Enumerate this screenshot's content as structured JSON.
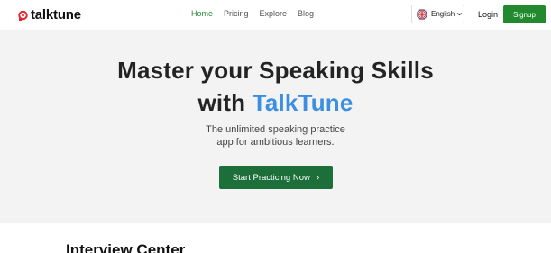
{
  "header": {
    "logo_text": "talktune",
    "nav": [
      {
        "label": "Home",
        "active": true
      },
      {
        "label": "Pricing",
        "active": false
      },
      {
        "label": "Explore",
        "active": false
      },
      {
        "label": "Blog",
        "active": false
      }
    ],
    "language": {
      "label": "English",
      "flag_icon": "uk-flag-icon"
    },
    "login_label": "Login",
    "signup_label": "Signup"
  },
  "hero": {
    "title_line1": "Master your Speaking Skills",
    "title_line2_prefix": "with ",
    "title_brand": "TalkTune",
    "subtitle_line1": "The unlimited speaking practice",
    "subtitle_line2": "app for ambitious learners.",
    "cta_label": "Start Practicing Now",
    "cta_arrow": "›"
  },
  "section": {
    "title": "Interview Center"
  },
  "colors": {
    "brand_blue": "#3b8ee0",
    "primary_green": "#21892e",
    "cta_green": "#1d6f3a",
    "active_nav": "#2e8b3d",
    "hero_bg": "#f3f3f3"
  }
}
